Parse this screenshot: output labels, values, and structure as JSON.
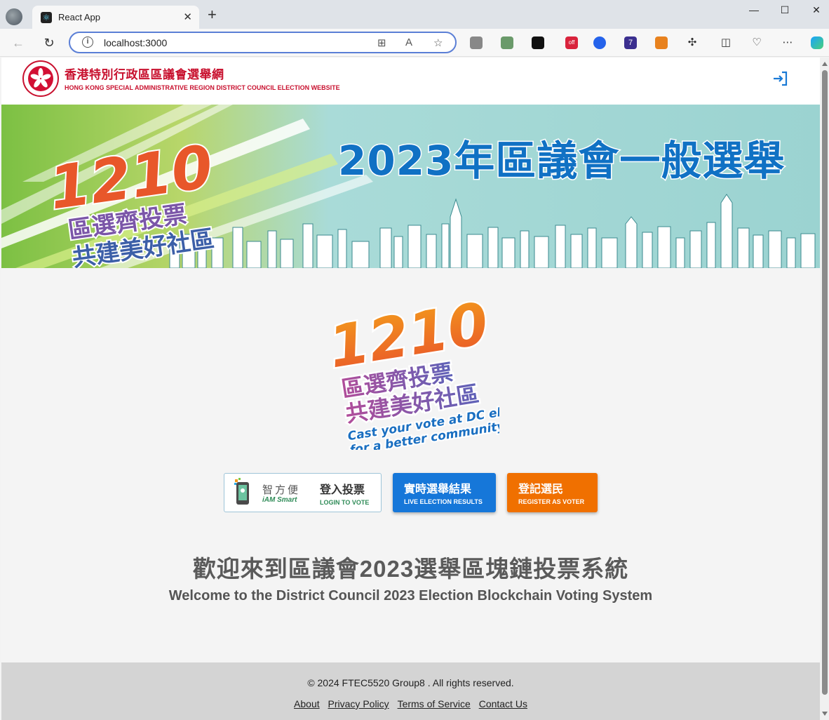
{
  "browser": {
    "tab_title": "React App",
    "tab_favicon": "react-icon",
    "new_tab": "+",
    "close_tab": "✕",
    "window_controls": {
      "minimize": "—",
      "maximize": "☐",
      "close": "✕"
    },
    "url": "localhost:3000",
    "nav": {
      "back": "←",
      "refresh": "↻"
    }
  },
  "site": {
    "title_zh": "香港特別行政區區議會選舉網",
    "title_en": "HONG KONG SPECIAL ADMINISTRATIVE REGION DISTRICT COUNCIL ELECTION WEBSITE",
    "login_icon": "login-icon"
  },
  "banner": {
    "date": "1210",
    "slogan_line1": "區選齊投票",
    "slogan_line2": "共建美好社區",
    "title": "2023年區議會一般選舉"
  },
  "main_logo": {
    "date": "1210",
    "slogan_line1": "區選齊投票",
    "slogan_line2": "共建美好社區",
    "en_line1": "Cast your vote at DC election",
    "en_line2": "for a better community"
  },
  "buttons": {
    "iam": {
      "brand_zh": "智方便",
      "brand_en": "iAM Smart",
      "zh": "登入投票",
      "en": "LOGIN TO VOTE"
    },
    "live": {
      "zh": "實時選舉結果",
      "en": "LIVE ELECTION RESULTS"
    },
    "register": {
      "zh": "登記選民",
      "en": "REGISTER AS VOTER"
    }
  },
  "welcome": {
    "zh": "歡迎來到區議會2023選舉區塊鏈投票系統",
    "en": "Welcome to the District Council 2023 Election Blockchain Voting System"
  },
  "footer": {
    "copyright": "© 2024 FTEC5520 Group8 . All rights reserved.",
    "links": [
      "About",
      "Privacy Policy",
      "Terms of Service",
      "Contact Us"
    ]
  },
  "colors": {
    "brand_red": "#c8102e",
    "live_blue": "#1677d9",
    "register_orange": "#f07000",
    "banner_title_blue": "#1071c4"
  }
}
